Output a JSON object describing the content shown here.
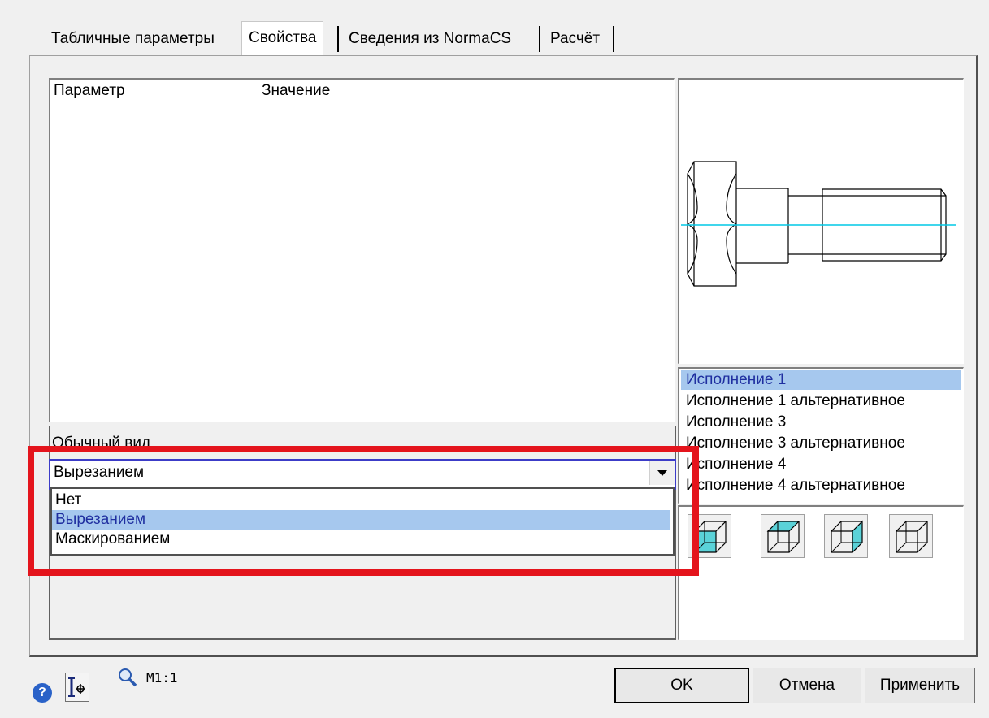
{
  "tabs": [
    {
      "label": "Табличные параметры"
    },
    {
      "label": "Свойства"
    },
    {
      "label": "Сведения из NormaCS"
    },
    {
      "label": "Расчёт"
    }
  ],
  "params_table": {
    "columns": [
      "Параметр",
      "Значение"
    ]
  },
  "view_group": {
    "label": "Обычный вид",
    "select": {
      "value": "Вырезанием",
      "options": [
        "Нет",
        "Вырезанием",
        "Маскированием"
      ],
      "selected_index": 1
    }
  },
  "variants": {
    "items": [
      "Исполнение 1",
      "Исполнение 1 альтернативное",
      "Исполнение 3",
      "Исполнение 3 альтернативное",
      "Исполнение 4",
      "Исполнение 4 альтернативное"
    ],
    "selected_index": 0
  },
  "view_buttons": [
    "cube-front-face-icon",
    "cube-top-face-icon",
    "cube-side-face-icon",
    "cube-wireframe-icon"
  ],
  "status": {
    "help_icon": "help-icon",
    "snap_icon": "snap-point-icon",
    "zoom_icon": "zoom-icon",
    "scale": "М1:1"
  },
  "buttons": {
    "ok": "OK",
    "cancel": "Отмена",
    "apply": "Применить"
  },
  "colors": {
    "selection": "#a6c8ee",
    "selection_text": "#1f2fa0",
    "axis_line": "#00c8e6",
    "cube_fill": "#5ad2d8",
    "highlight_frame": "#e4141c"
  }
}
